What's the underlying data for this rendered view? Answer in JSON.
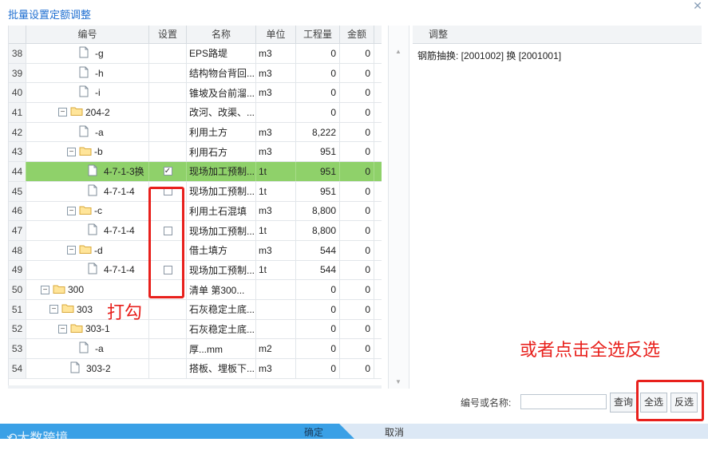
{
  "window": {
    "title": "批量设置定额调整"
  },
  "columns": {
    "code": "编号",
    "set": "设置",
    "name": "名称",
    "unit": "单位",
    "qty": "工程量",
    "amount": "金额"
  },
  "rows": [
    {
      "n": "38",
      "indent": 3,
      "type": "file",
      "code": "-g",
      "checked": null,
      "name": "EPS路堤",
      "unit": "m3",
      "qty": "0",
      "amount": "0"
    },
    {
      "n": "39",
      "indent": 3,
      "type": "file",
      "code": "-h",
      "checked": null,
      "name": "结构物台背回...",
      "unit": "m3",
      "qty": "0",
      "amount": "0"
    },
    {
      "n": "40",
      "indent": 3,
      "type": "file",
      "code": "-i",
      "checked": null,
      "name": "锥坡及台前溜...",
      "unit": "m3",
      "qty": "0",
      "amount": "0"
    },
    {
      "n": "41",
      "indent": 2,
      "type": "folder",
      "code": "204-2",
      "checked": null,
      "name": "改河、改渠、...",
      "unit": "",
      "qty": "0",
      "amount": "0"
    },
    {
      "n": "42",
      "indent": 3,
      "type": "file",
      "code": "-a",
      "checked": null,
      "name": "利用土方",
      "unit": "m3",
      "qty": "8,222",
      "amount": "0"
    },
    {
      "n": "43",
      "indent": 3,
      "type": "folder",
      "code": "-b",
      "checked": null,
      "name": "利用石方",
      "unit": "m3",
      "qty": "951",
      "amount": "0"
    },
    {
      "n": "44",
      "indent": 4,
      "type": "file",
      "code": "4-7-1-3换",
      "checked": true,
      "name": "现场加工预制...",
      "unit": "1t",
      "qty": "951",
      "amount": "0",
      "selected": true
    },
    {
      "n": "45",
      "indent": 4,
      "type": "file",
      "code": "4-7-1-4",
      "checked": false,
      "name": "现场加工预制...",
      "unit": "1t",
      "qty": "951",
      "amount": "0"
    },
    {
      "n": "46",
      "indent": 3,
      "type": "folder",
      "code": "-c",
      "checked": null,
      "name": "利用土石混填",
      "unit": "m3",
      "qty": "8,800",
      "amount": "0"
    },
    {
      "n": "47",
      "indent": 4,
      "type": "file",
      "code": "4-7-1-4",
      "checked": false,
      "name": "现场加工预制...",
      "unit": "1t",
      "qty": "8,800",
      "amount": "0"
    },
    {
      "n": "48",
      "indent": 3,
      "type": "folder",
      "code": "-d",
      "checked": null,
      "name": "借土填方",
      "unit": "m3",
      "qty": "544",
      "amount": "0"
    },
    {
      "n": "49",
      "indent": 4,
      "type": "file",
      "code": "4-7-1-4",
      "checked": false,
      "name": "现场加工预制...",
      "unit": "1t",
      "qty": "544",
      "amount": "0"
    },
    {
      "n": "50",
      "indent": 0,
      "type": "folder",
      "code": "300",
      "checked": null,
      "name": "清单 第300...",
      "unit": "",
      "qty": "0",
      "amount": "0"
    },
    {
      "n": "51",
      "indent": 1,
      "type": "folder",
      "code": "303",
      "checked": null,
      "name": "石灰稳定土底...",
      "unit": "",
      "qty": "0",
      "amount": "0"
    },
    {
      "n": "52",
      "indent": 2,
      "type": "folder",
      "code": "303-1",
      "checked": null,
      "name": "石灰稳定土底...",
      "unit": "",
      "qty": "0",
      "amount": "0"
    },
    {
      "n": "53",
      "indent": 3,
      "type": "file",
      "code": "-a",
      "checked": null,
      "name": "厚...mm",
      "unit": "m2",
      "qty": "0",
      "amount": "0"
    },
    {
      "n": "54",
      "indent": 2,
      "type": "file",
      "code": "303-2",
      "checked": null,
      "name": "搭板、埋板下...",
      "unit": "m3",
      "qty": "0",
      "amount": "0"
    }
  ],
  "adjust": {
    "header": "调整",
    "text": "钢筋抽换: [2001002] 换 [2001001]"
  },
  "annotations": {
    "tick": "打勾",
    "select_all_hint": "或者点击全选反选"
  },
  "search": {
    "label": "编号或名称:",
    "value": "",
    "query_btn": "查询",
    "select_all_btn": "全选",
    "invert_btn": "反选"
  },
  "footer": {
    "ok": "确定",
    "cancel": "取消"
  },
  "watermark": "大数跨境",
  "colors": {
    "title": "#1f6fd1",
    "selected_row": "#8fd16a",
    "annotation": "#e8201c",
    "ok_bar": "#3aa0e6"
  }
}
